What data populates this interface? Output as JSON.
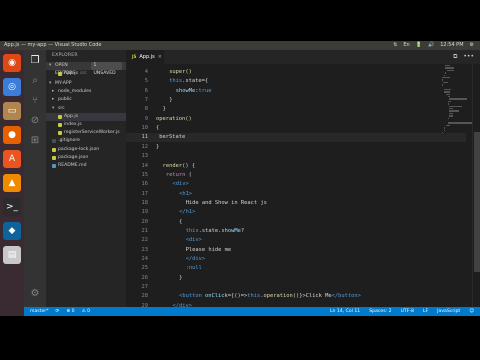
{
  "topbar": {
    "title": "App.js — my-app — Visual Studio Code",
    "tray": [
      "⇅",
      "En",
      "🔋",
      "🔊",
      "12:54 PM",
      "⚙"
    ]
  },
  "launcher": {
    "items": [
      {
        "name": "ubuntu-dash-icon",
        "glyph": "◉",
        "color": "#dd4814"
      },
      {
        "name": "chrome-icon",
        "glyph": "◎",
        "color": "#3b7dd8"
      },
      {
        "name": "files-icon",
        "glyph": "▭",
        "color": "#b08550"
      },
      {
        "name": "firefox-icon",
        "glyph": "●",
        "color": "#e66000"
      },
      {
        "name": "software-center-icon",
        "glyph": "A",
        "color": "#e95420"
      },
      {
        "name": "vlc-icon",
        "glyph": "▲",
        "color": "#f08a00"
      },
      {
        "name": "terminal-icon",
        "glyph": ">_",
        "color": "#2c2c2c"
      },
      {
        "name": "vscode-icon",
        "glyph": "◆",
        "color": "#0e639c"
      },
      {
        "name": "writer-icon",
        "glyph": "▤",
        "color": "#c8c8c8"
      }
    ]
  },
  "activity": {
    "items": [
      "explorer-icon",
      "search-icon",
      "source-control-icon",
      "debug-icon",
      "extensions-icon"
    ],
    "glyphs": [
      "❐",
      "⌕",
      "⑂",
      "⊘",
      "⊞"
    ],
    "gear": "⚙"
  },
  "sidebar": {
    "title": "EXPLORER",
    "open_editors_label": "OPEN EDITORS",
    "open_editors_badge": "1 UNSAVED",
    "open_file": "App.js",
    "open_file_path": "src",
    "project_label": "MY-APP",
    "tree": [
      {
        "label": "node_modules",
        "depth": 1,
        "folder": true,
        "icon": ""
      },
      {
        "label": "public",
        "depth": 1,
        "folder": true,
        "icon": ""
      },
      {
        "label": "src",
        "depth": 1,
        "folder": true,
        "open": true,
        "icon": ""
      },
      {
        "label": "App.js",
        "depth": 2,
        "folder": false,
        "icon": "#cbcb41",
        "selected": true
      },
      {
        "label": "index.js",
        "depth": 2,
        "folder": false,
        "icon": "#cbcb41"
      },
      {
        "label": "registerServiceWorker.js",
        "depth": 2,
        "folder": false,
        "icon": "#cbcb41"
      },
      {
        "label": ".gitignore",
        "depth": 1,
        "folder": false,
        "icon": "#41535b"
      },
      {
        "label": "package-lock.json",
        "depth": 1,
        "folder": false,
        "icon": "#cbcb41"
      },
      {
        "label": "package.json",
        "depth": 1,
        "folder": false,
        "icon": "#cbcb41"
      },
      {
        "label": "README.md",
        "depth": 1,
        "folder": false,
        "icon": "#519aba"
      }
    ]
  },
  "tab": {
    "label": "App.js",
    "icon_text": "JS",
    "close": "×",
    "actions": [
      "⧉",
      "•••"
    ]
  },
  "code": [
    {
      "n": "4",
      "indent": 4,
      "parts": [
        [
          "super()",
          "#dcdcaa"
        ]
      ]
    },
    {
      "n": "5",
      "indent": 4,
      "parts": [
        [
          "this",
          "#569cd6"
        ],
        [
          ".state={",
          "#d4d4d4"
        ]
      ]
    },
    {
      "n": "6",
      "indent": 6,
      "parts": [
        [
          "showMe",
          "#9cdcfe"
        ],
        [
          ":",
          "#d4d4d4"
        ],
        [
          "true",
          "#569cd6"
        ]
      ]
    },
    {
      "n": "7",
      "indent": 4,
      "parts": [
        [
          "}",
          "#d4d4d4"
        ]
      ]
    },
    {
      "n": "8",
      "indent": 2,
      "parts": [
        [
          "}",
          "#d4d4d4"
        ]
      ]
    },
    {
      "n": "9",
      "indent": 0,
      "parts": [
        [
          "operation()",
          "#dcdcaa"
        ]
      ]
    },
    {
      "n": "10",
      "indent": 0,
      "parts": [
        [
          "{",
          "#d4d4d4"
        ]
      ]
    },
    {
      "n": "11",
      "indent": 1,
      "parts": [
        [
          "berState",
          "#d4d4d4"
        ]
      ],
      "current": true
    },
    {
      "n": "12",
      "indent": 0,
      "parts": [
        [
          "}",
          "#d4d4d4"
        ]
      ]
    },
    {
      "n": "13",
      "indent": 0,
      "parts": []
    },
    {
      "n": "14",
      "indent": 2,
      "parts": [
        [
          "render",
          "#dcdcaa"
        ],
        [
          "() {",
          "#d4d4d4"
        ]
      ]
    },
    {
      "n": "15",
      "indent": 3,
      "parts": [
        [
          "return",
          "#c586c0"
        ],
        [
          " (",
          "#d4d4d4"
        ]
      ]
    },
    {
      "n": "16",
      "indent": 5,
      "parts": [
        [
          "<div>",
          "#569cd6"
        ]
      ]
    },
    {
      "n": "17",
      "indent": 7,
      "parts": [
        [
          "<h1>",
          "#569cd6"
        ]
      ]
    },
    {
      "n": "18",
      "indent": 9,
      "parts": [
        [
          "Hide and Show in React js",
          "#d4d4d4"
        ]
      ]
    },
    {
      "n": "19",
      "indent": 7,
      "parts": [
        [
          "</h1>",
          "#569cd6"
        ]
      ]
    },
    {
      "n": "20",
      "indent": 7,
      "parts": [
        [
          "{",
          "#d4d4d4"
        ]
      ]
    },
    {
      "n": "21",
      "indent": 9,
      "parts": [
        [
          "this",
          "#569cd6"
        ],
        [
          ".state.",
          "#d4d4d4"
        ],
        [
          "showMe",
          "#9cdcfe"
        ],
        [
          "?",
          "#d4d4d4"
        ]
      ]
    },
    {
      "n": "22",
      "indent": 9,
      "parts": [
        [
          "<div>",
          "#569cd6"
        ]
      ]
    },
    {
      "n": "23",
      "indent": 9,
      "parts": [
        [
          "Please hide me",
          "#d4d4d4"
        ]
      ]
    },
    {
      "n": "24",
      "indent": 9,
      "parts": [
        [
          "</div>",
          "#569cd6"
        ]
      ]
    },
    {
      "n": "25",
      "indent": 9,
      "parts": [
        [
          ":null",
          "#569cd6"
        ]
      ]
    },
    {
      "n": "26",
      "indent": 7,
      "parts": [
        [
          "}",
          "#d4d4d4"
        ]
      ]
    },
    {
      "n": "27",
      "indent": 0,
      "parts": []
    },
    {
      "n": "28",
      "indent": 7,
      "parts": [
        [
          "<button",
          "#569cd6"
        ],
        [
          " onClick",
          "#9cdcfe"
        ],
        [
          "={()=>",
          "#d4d4d4"
        ],
        [
          "this",
          "#569cd6"
        ],
        [
          ".",
          "#d4d4d4"
        ],
        [
          "operation",
          "#dcdcaa"
        ],
        [
          "()}>Click Me",
          "#d4d4d4"
        ],
        [
          "</button>",
          "#569cd6"
        ]
      ]
    },
    {
      "n": "29",
      "indent": 5,
      "parts": [
        [
          "</div>",
          "#569cd6"
        ]
      ]
    },
    {
      "n": "30",
      "indent": 3,
      "parts": [
        [
          ")",
          "#d4d4d4"
        ]
      ]
    },
    {
      "n": "31",
      "indent": 2,
      "parts": [
        [
          "}",
          "#d4d4d4"
        ]
      ]
    },
    {
      "n": "32",
      "indent": 0,
      "parts": [
        [
          "}",
          "#d4d4d4"
        ]
      ]
    }
  ],
  "status": {
    "branch": "master*",
    "sync": "⟳",
    "errors": "⊗ 0",
    "warnings": "⚠ 0",
    "position": "Ln 14, Col 11",
    "spaces": "Spaces: 2",
    "encoding": "UTF-8",
    "eol": "LF",
    "language": "JavaScript",
    "feedback": "☺"
  }
}
